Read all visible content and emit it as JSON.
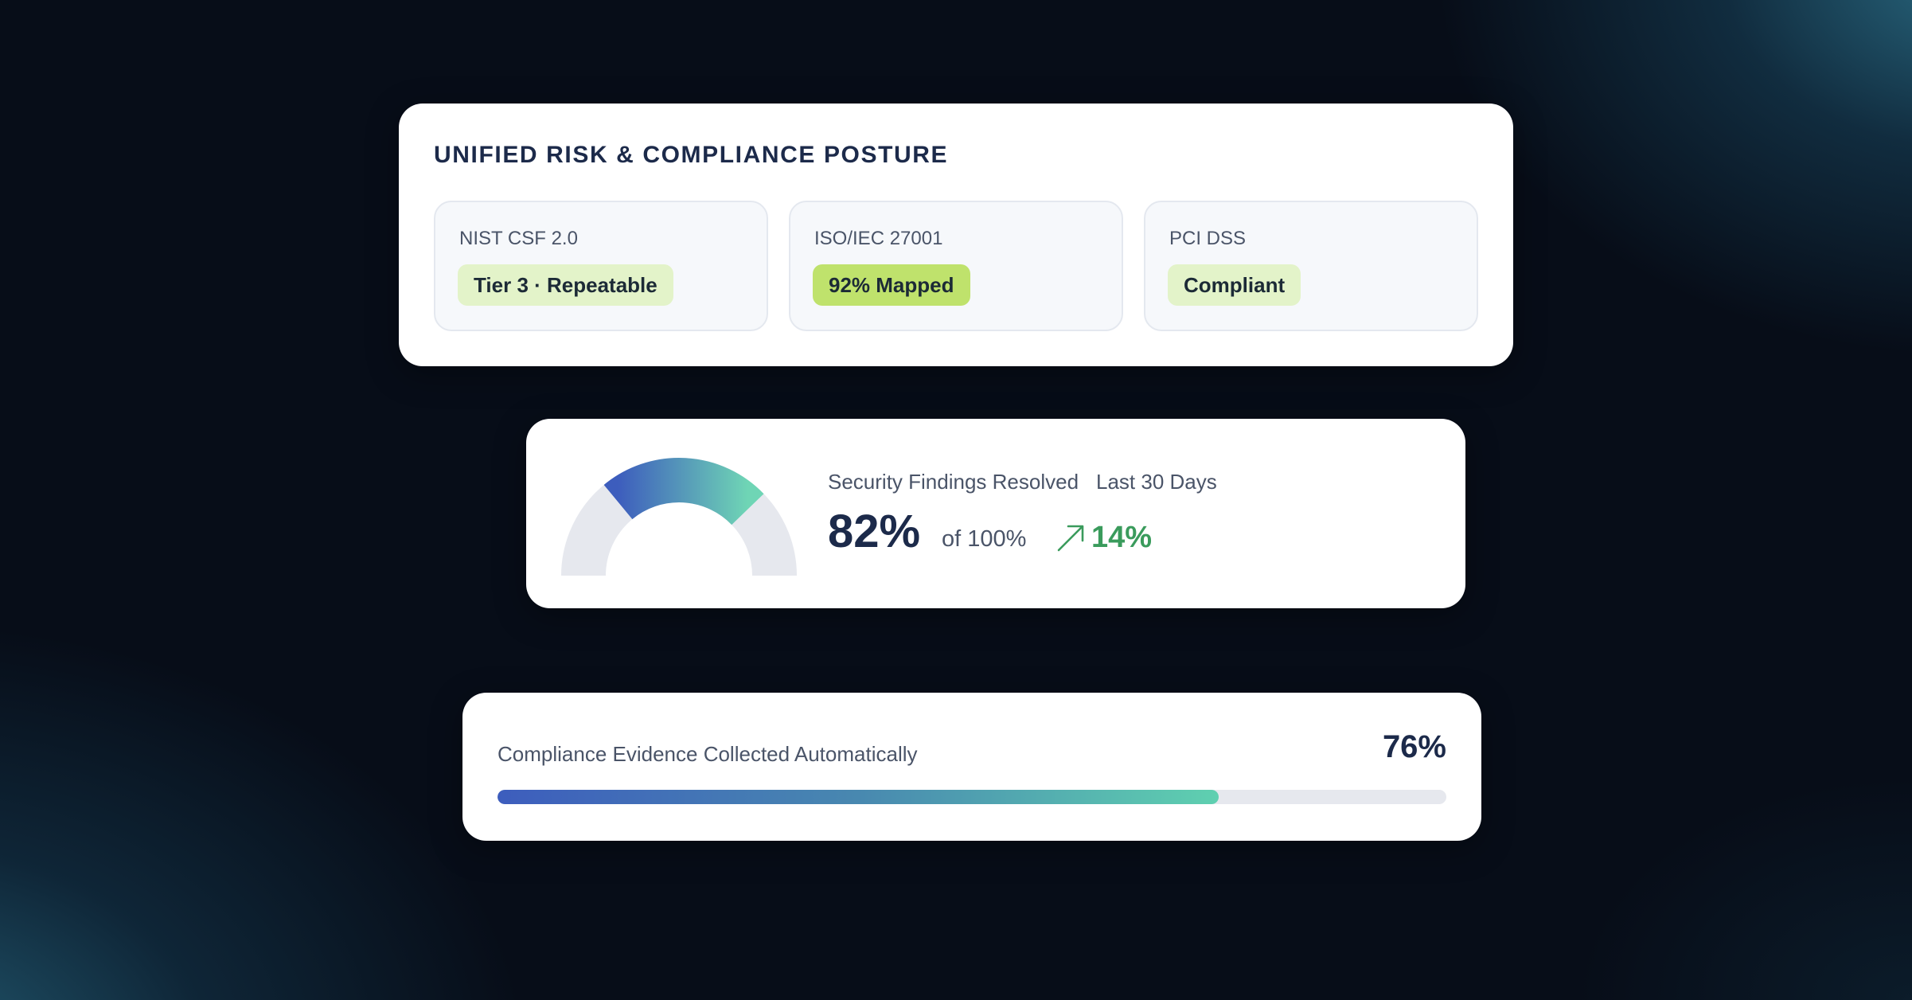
{
  "posture": {
    "title": "UNIFIED RISK & COMPLIANCE POSTURE",
    "frameworks": [
      {
        "name": "NIST CSF 2.0",
        "status": "Tier 3 · Repeatable"
      },
      {
        "name": "ISO/IEC 27001",
        "status": "92% Mapped"
      },
      {
        "name": "PCI DSS",
        "status": "Compliant"
      }
    ]
  },
  "findings": {
    "label": "Security Findings Resolved",
    "period": "Last 30 Days",
    "value_text": "82%",
    "value": 82,
    "max_text": "of 100%",
    "trend_text": "14%",
    "trend_direction": "up",
    "colors": {
      "gauge_start": "#3d5dbd",
      "gauge_end": "#6fd5b5",
      "gauge_track": "#e6e8ee",
      "trend": "#3a9b5c"
    }
  },
  "evidence": {
    "label": "Compliance Evidence Collected Automatically",
    "value_text": "76%",
    "value": 76
  },
  "icons": {
    "trend": "arrow-up-right-icon"
  }
}
